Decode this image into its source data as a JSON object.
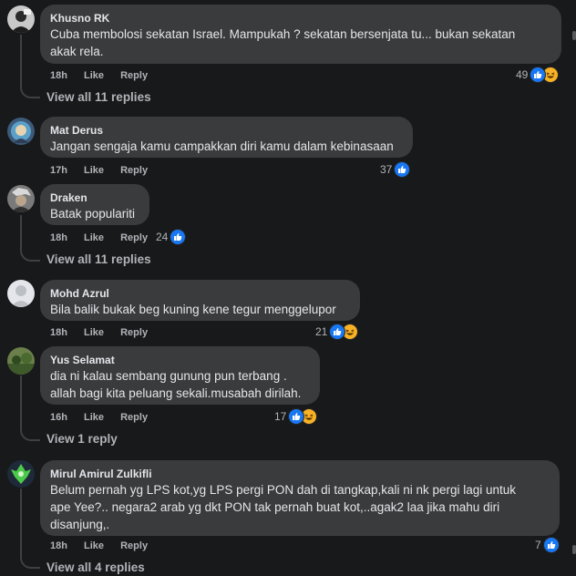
{
  "comments": [
    {
      "author": "Khusno RK",
      "text": "Cuba membolosi sekatan Israel. Mampukah ? sekatan bersenjata tu... bukan sekatan\nakak rela.",
      "time": "18h",
      "like": "Like",
      "reply": "Reply",
      "reaction_count": "49",
      "reactions": [
        "like-icon",
        "haha-icon"
      ],
      "view_replies": "View all 11 replies"
    },
    {
      "author": "Mat Derus",
      "text": "Jangan sengaja kamu campakkan diri kamu dalam kebinasaan",
      "time": "17h",
      "like": "Like",
      "reply": "Reply",
      "reaction_count": "37",
      "reactions": [
        "like-icon"
      ]
    },
    {
      "author": "Draken",
      "text": "Batak populariti",
      "time": "18h",
      "like": "Like",
      "reply": "Reply",
      "reaction_count": "24",
      "reactions": [
        "like-icon"
      ],
      "view_replies": "View all 11 replies"
    },
    {
      "author": "Mohd Azrul",
      "text": "Bila balik bukak beg kuning kene tegur menggelupor",
      "time": "18h",
      "like": "Like",
      "reply": "Reply",
      "reaction_count": "21",
      "reactions": [
        "like-icon",
        "haha-icon"
      ]
    },
    {
      "author": "Yus Selamat",
      "text": "dia ni kalau sembang gunung pun terbang .\nallah bagi kita peluang sekali.musabah dirilah.",
      "time": "16h",
      "like": "Like",
      "reply": "Reply",
      "reaction_count": "17",
      "reactions": [
        "like-icon",
        "haha-icon"
      ],
      "view_replies": "View 1 reply"
    },
    {
      "author": "Mirul Amirul Zulkifli",
      "text": "Belum pernah yg LPS kot,yg LPS pergi PON dah di tangkap,kali ni nk pergi lagi untuk\nape Yee?.. negara2 arab yg dkt PON tak pernah buat kot,..agak2 laa jika mahu diri\ndisanjung,.",
      "time": "18h",
      "like": "Like",
      "reply": "Reply",
      "reaction_count": "7",
      "reactions": [
        "like-icon"
      ],
      "view_replies": "View all 4 replies"
    }
  ],
  "colors": {
    "like": "#1877f2",
    "haha": "#f7b125",
    "bubble": "#3a3b3c",
    "bg": "#18191a"
  }
}
